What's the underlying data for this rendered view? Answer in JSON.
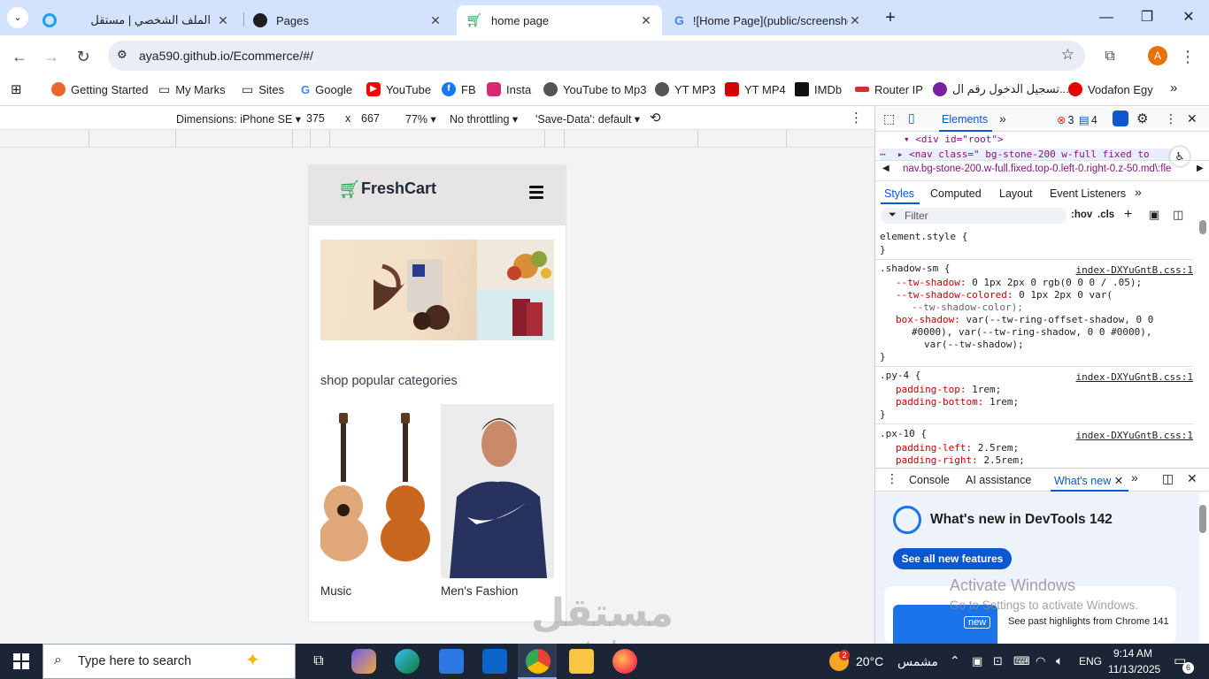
{
  "browser": {
    "tabs": [
      {
        "title": "الملف الشخصي | مستقل"
      },
      {
        "title": "Pages"
      },
      {
        "title": "home page"
      },
      {
        "title": "![Home Page](public/screensho"
      }
    ],
    "url": "aya590.github.io/Ecommerce/#/",
    "profile_initial": "A",
    "bookmarks": [
      {
        "label": "Getting Started",
        "color": "#e8672d"
      },
      {
        "label": "My Marks"
      },
      {
        "label": "Sites"
      },
      {
        "label": "Google"
      },
      {
        "label": "YouTube"
      },
      {
        "label": "FB"
      },
      {
        "label": "Insta"
      },
      {
        "label": "YouTube to Mp3"
      },
      {
        "label": "YT MP3"
      },
      {
        "label": "YT MP4"
      },
      {
        "label": "IMDb"
      },
      {
        "label": "Router IP"
      },
      {
        "label": "تسجيل الدخول رقم ال..."
      },
      {
        "label": "Vodafon Egy"
      }
    ]
  },
  "device_toolbar": {
    "dimensions": "Dimensions: iPhone SE",
    "width": "375",
    "times": "x",
    "height": "667",
    "zoom": "77%",
    "throttling": "No throttling",
    "save_data": "'Save-Data': default"
  },
  "page": {
    "brand": "FreshCart",
    "categories_heading": "shop popular categories",
    "categories": [
      {
        "label": "Music"
      },
      {
        "label": "Men's Fashion"
      }
    ]
  },
  "devtools": {
    "top_tab": "Elements",
    "errors": "3",
    "messages": "4",
    "dom_line1": "<div id=\"root\">",
    "dom_line2": "<nav class=\" bg-stone-200  w-full fixed  to",
    "breadcrumb": "nav.bg-stone-200.w-full.fixed.top-0.left-0.right-0.z-50.md\\:fle",
    "subtabs": [
      "Styles",
      "Computed",
      "Layout",
      "Event Listeners"
    ],
    "filter_placeholder": "Filter",
    "hov": ":hov",
    "cls": ".cls",
    "element_style": "element.style {",
    "close_brace": "}",
    "source": "index-DXYuGntB.css:1",
    "rules": {
      "shadow_selector": ".shadow-sm {",
      "shadow_l1_prop": "--tw-shadow:",
      "shadow_l1_val": "0 1px 2px 0 rgb(0 0 0 / .05);",
      "shadow_l2_prop": "--tw-shadow-colored:",
      "shadow_l2_val": "0 1px 2px 0 var(",
      "shadow_l3_val": "--tw-shadow-color);",
      "shadow_l4_prop": "box-shadow:",
      "shadow_l4_val": "var(--tw-ring-offset-shadow, 0 0",
      "shadow_l5_val": "#0000), var(--tw-ring-shadow, 0 0 #0000),",
      "shadow_l6_val": "var(--tw-shadow);",
      "py_selector": ".py-4 {",
      "py_l1_prop": "padding-top:",
      "py_l1_val": "1rem;",
      "py_l2_prop": "padding-bottom:",
      "py_l2_val": "1rem;",
      "px_selector": ".px-10 {",
      "px_l1_prop": "padding-left:",
      "px_l1_val": "2.5rem;",
      "px_l2_prop": "padding-right:",
      "px_l2_val": "2.5rem;"
    },
    "drawer_tabs": [
      "Console",
      "AI assistance",
      "What's new"
    ],
    "whats_new_title": "What's new in DevTools 142",
    "see_all": "See all new features",
    "new_badge": "new",
    "past_highlights": "See past highlights from Chrome 141",
    "activate_title": "Activate Windows",
    "activate_sub": "Go to Settings to activate Windows."
  },
  "taskbar": {
    "search_placeholder": "Type here to search",
    "weather_badge": "2",
    "temperature": "20°C",
    "weather_text": "مشمس",
    "lang": "ENG",
    "time": "9:14 AM",
    "date": "11/13/2025",
    "notif_count": "6"
  },
  "watermark": {
    "logo_text": "مستقل",
    "domain": "mostaql.com"
  },
  "colors": {
    "tabstrip": "#d3e3fd",
    "accent_blue": "#0b57d0",
    "fc_green": "#16a34a",
    "taskbar": "#1b2536"
  }
}
